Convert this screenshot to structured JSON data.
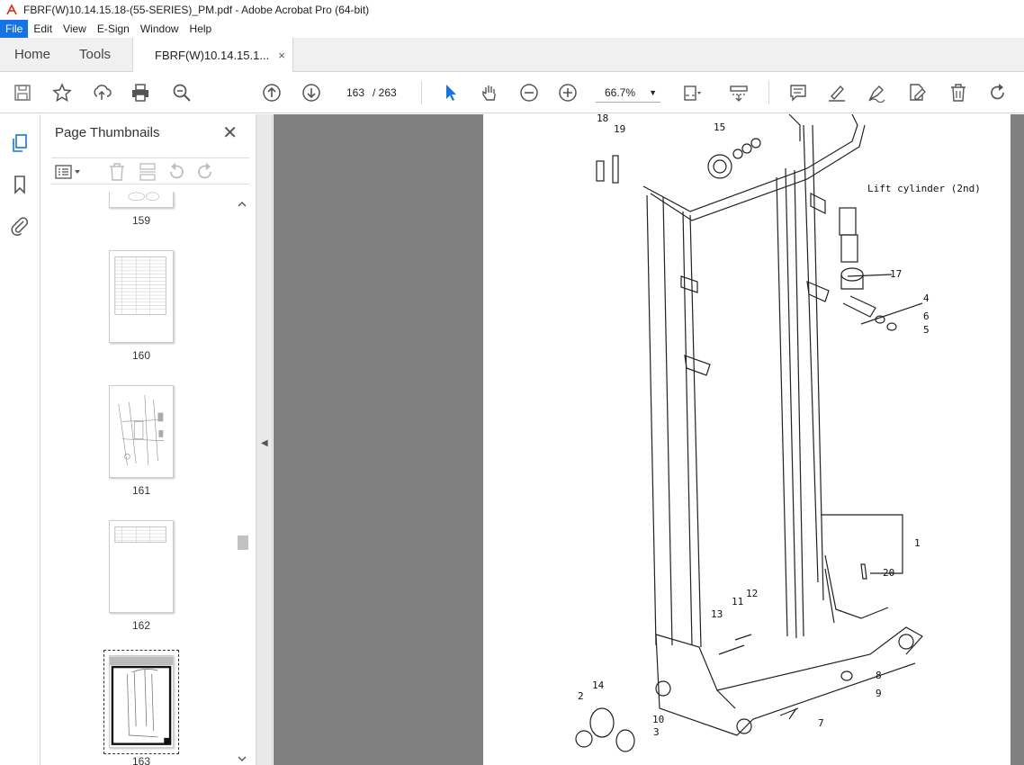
{
  "window": {
    "title": "FBRF(W)10.14.15.18-(55-SERIES)_PM.pdf - Adobe Acrobat Pro (64-bit)"
  },
  "menu": [
    "File",
    "Edit",
    "View",
    "E-Sign",
    "Window",
    "Help"
  ],
  "tabs": {
    "home": "Home",
    "tools": "Tools",
    "document": "FBRF(W)10.14.15.1...",
    "close": "×"
  },
  "toolbar": {
    "page_current": "163",
    "page_separator": "/ 263",
    "zoom": "66.7%",
    "zoom_caret": "▼"
  },
  "panel": {
    "title": "Page Thumbnails",
    "close": "✕",
    "thumbnails": [
      {
        "label": "159"
      },
      {
        "label": "160"
      },
      {
        "label": "161"
      },
      {
        "label": "162"
      },
      {
        "label": "163"
      }
    ]
  },
  "collapse_arrow": "◀",
  "drawing": {
    "title": "Lift cylinder (2nd)",
    "callouts": [
      "18",
      "19",
      "15",
      "17",
      "4",
      "6",
      "5",
      "1",
      "20",
      "12",
      "11",
      "13",
      "14",
      "2",
      "10",
      "3",
      "8",
      "9",
      "7"
    ]
  },
  "colors": {
    "accent": "#1473e6",
    "doc_bg": "#808080",
    "pdf_red": "#d9291c"
  }
}
